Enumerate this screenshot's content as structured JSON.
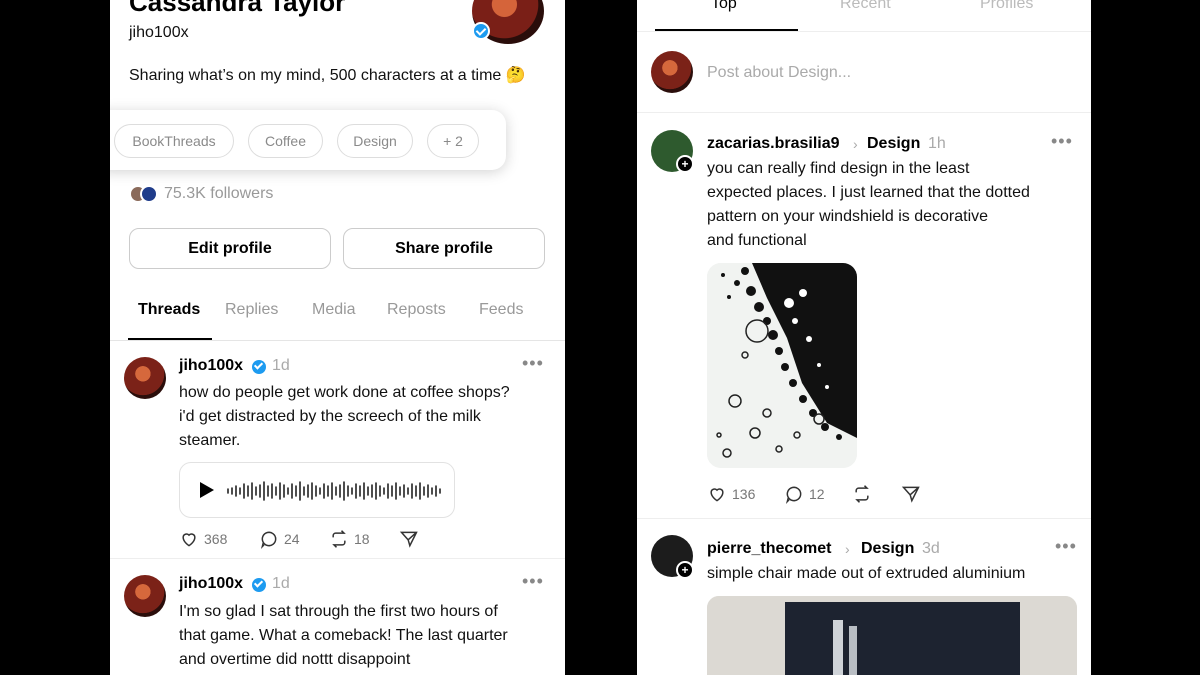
{
  "profile": {
    "name": "Cassandra Taylor",
    "handle": "jiho100x",
    "bio": "Sharing what’s on my mind, 500 characters at a time 🤔",
    "tags": [
      "BookThreads",
      "Coffee",
      "Design",
      "+ 2"
    ],
    "followers": "75.3K followers",
    "edit_label": "Edit profile",
    "share_label": "Share profile"
  },
  "profile_tabs": [
    "Threads",
    "Replies",
    "Media",
    "Reposts",
    "Feeds"
  ],
  "left_posts": [
    {
      "author": "jiho100x",
      "time": "1d",
      "lines": [
        "how do people get work done at coffee shops?",
        "i'd get distracted by the screech of the milk",
        "steamer."
      ],
      "likes": "368",
      "replies": "24",
      "reposts": "18"
    },
    {
      "author": "jiho100x",
      "time": "1d",
      "lines": [
        "I'm so glad I sat through the first two hours of",
        "that game. What a comeback! The last quarter",
        "and overtime did nottt disappoint"
      ]
    }
  ],
  "feed_tabs": [
    "Top",
    "Recent",
    "Profiles"
  ],
  "compose": {
    "placeholder": "Post about Design..."
  },
  "right_posts": [
    {
      "author": "zacarias.brasilia9",
      "topic": "Design",
      "time": "1h",
      "lines": [
        "you can really find design in the least",
        "expected places. I just learned that the dotted",
        "pattern on your windshield is decorative",
        "and functional"
      ],
      "likes": "136",
      "replies": "12"
    },
    {
      "author": "pierre_thecomet",
      "topic": "Design",
      "time": "3d",
      "lines": [
        "simple chair made out of extruded aluminium"
      ]
    }
  ],
  "colors": {
    "verified": "#1d9bf0",
    "muted": "#999999"
  }
}
